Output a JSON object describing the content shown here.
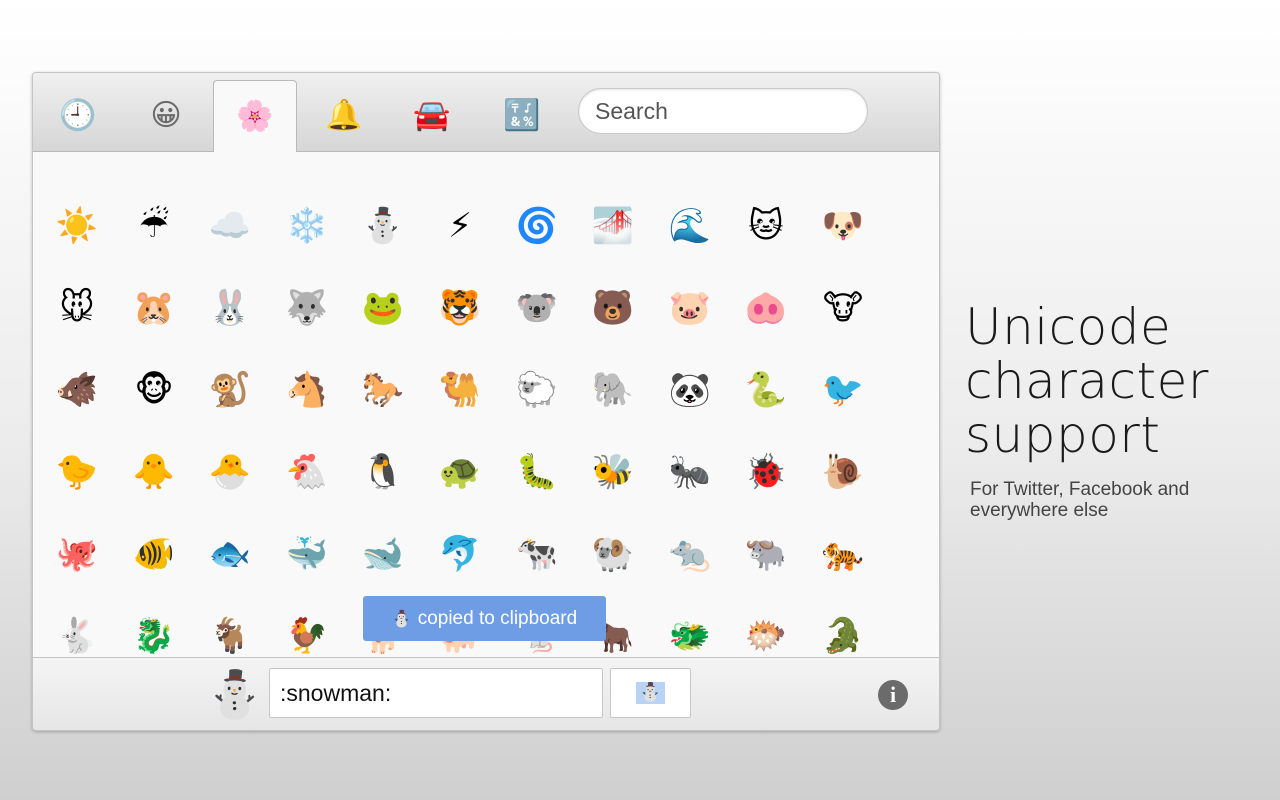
{
  "tabs": [
    {
      "name": "recent",
      "icon": "🕘"
    },
    {
      "name": "people",
      "icon": "😀"
    },
    {
      "name": "nature",
      "icon": "🌸"
    },
    {
      "name": "objects",
      "icon": "🔔"
    },
    {
      "name": "places",
      "icon": "🚘"
    },
    {
      "name": "symbols",
      "icon": "🔣"
    }
  ],
  "active_tab": "nature",
  "search": {
    "placeholder": "Search",
    "value": ""
  },
  "emoji_rows": [
    [
      "☀️",
      "☔",
      "☁️",
      "❄️",
      "⛄",
      "⚡",
      "🌀",
      "🌁",
      "🌊",
      "🐱",
      "🐶"
    ],
    [
      "🐭",
      "🐹",
      "🐰",
      "🐺",
      "🐸",
      "🐯",
      "🐨",
      "🐻",
      "🐷",
      "🐽",
      "🐮"
    ],
    [
      "🐗",
      "🐵",
      "🐒",
      "🐴",
      "🐎",
      "🐫",
      "🐑",
      "🐘",
      "🐼",
      "🐍",
      "🐦"
    ],
    [
      "🐤",
      "🐥",
      "🐣",
      "🐔",
      "🐧",
      "🐢",
      "🐛",
      "🐝",
      "🐜",
      "🐞",
      "🐌"
    ],
    [
      "🐙",
      "🐠",
      "🐟",
      "🐳",
      "🐋",
      "🐬",
      "🐄",
      "🐏",
      "🐀",
      "🐃",
      "🐅"
    ],
    [
      "🐇",
      "🐉",
      "🐐",
      "🐓",
      "🐕",
      "🐖",
      "🐁",
      "🐂",
      "🐲",
      "🐡",
      "🐊"
    ]
  ],
  "toast": {
    "glyph": "⛄",
    "text": "copied to clipboard"
  },
  "bottom": {
    "preview_glyph": "⛄",
    "name_value": ":snowman:",
    "copy_glyph": "⛄",
    "info_glyph": "i"
  },
  "promo": {
    "headline": [
      "Unicode",
      "character",
      "support"
    ],
    "subline": "For Twitter, Facebook and everywhere else"
  }
}
